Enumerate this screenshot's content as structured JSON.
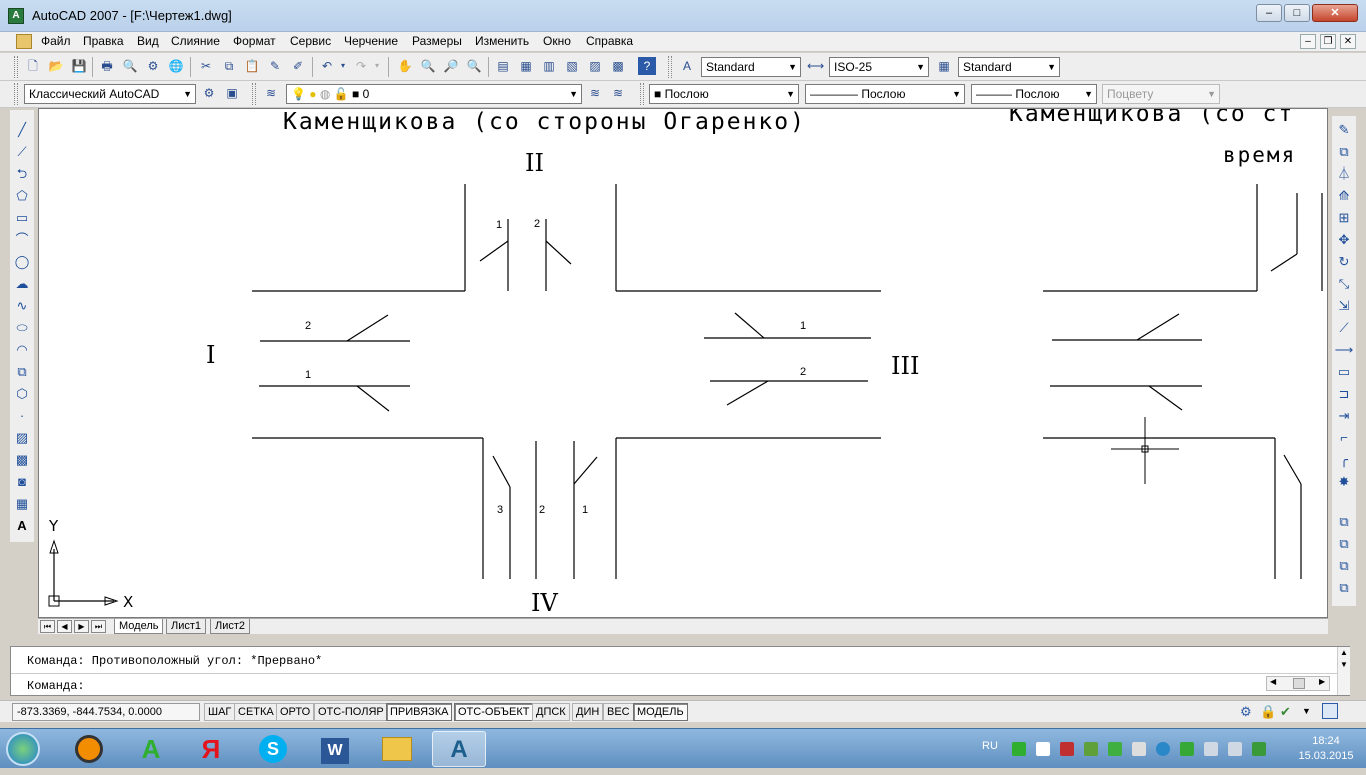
{
  "window": {
    "title": "AutoCAD 2007 - [F:\\Чертеж1.dwg]",
    "app_icon_letter": "A",
    "controls": {
      "minimize": "–",
      "maximize": "□",
      "close": "✕"
    }
  },
  "menu": {
    "items": [
      "Файл",
      "Правка",
      "Вид",
      "Слияние",
      "Формат",
      "Сервис",
      "Черчение",
      "Размеры",
      "Изменить",
      "Окно",
      "Справка"
    ],
    "mdi_controls": {
      "minimize": "–",
      "restore": "❐",
      "close": "✕"
    }
  },
  "toolbar_standard": {
    "text_style": "Standard",
    "dim_style": "ISO-25",
    "table_style": "Standard"
  },
  "toolbar_layers": {
    "workspace": "Классический AutoCAD",
    "layer": "0",
    "color": "Послою",
    "linetype": "Послою",
    "lineweight": "Послою",
    "plotstyle": "Поцвету"
  },
  "drawing": {
    "title_left": "Каменщикова (со стороны Огаренко)",
    "title_right": "Каменщикова (со ст",
    "subtitle_right": "время",
    "approach_labels": {
      "north": "II",
      "west": "I",
      "east": "III",
      "south": "IV"
    },
    "lane_labels": {
      "north_1": "1",
      "north_2": "2",
      "west_2": "2",
      "west_1": "1",
      "east_1": "1",
      "east_2": "2",
      "south_3": "3",
      "south_2": "2",
      "south_1": "1"
    },
    "ucs": {
      "x": "X",
      "y": "Y"
    }
  },
  "layout_tabs": {
    "nav": [
      "⏮",
      "◀",
      "▶",
      "⏭"
    ],
    "tabs": [
      "Модель",
      "Лист1",
      "Лист2"
    ],
    "active": "Модель"
  },
  "command": {
    "history": "Команда: Противоположный угол: *Прервано*",
    "prompt": "Команда:"
  },
  "status": {
    "coordinates": "-873.3369,  -844.7534, 0.0000",
    "buttons": [
      "ШАГ",
      "СЕТКА",
      "ОРТО",
      "ОТС-ПОЛЯР",
      "ПРИВЯЗКА",
      "ОТС-ОБЪЕКТ",
      "ДПСК",
      "ДИН",
      "ВЕС",
      "МОДЕЛЬ"
    ],
    "on": [
      "ПРИВЯЗКА",
      "ОТС-ОБЪЕКТ",
      "МОДЕЛЬ"
    ]
  },
  "taskbar": {
    "language": "RU",
    "time": "18:24",
    "date": "15.03.2015",
    "apps": [
      "avast-icon",
      "autocad-a-icon",
      "yandex-icon",
      "skype-icon",
      "word-icon",
      "explorer-icon",
      "autocad-active-icon"
    ]
  },
  "colors": {
    "drawing_bg": "#ffffff",
    "taskbar": "#6f9bc8",
    "titlebar": "#c9dcf0"
  }
}
